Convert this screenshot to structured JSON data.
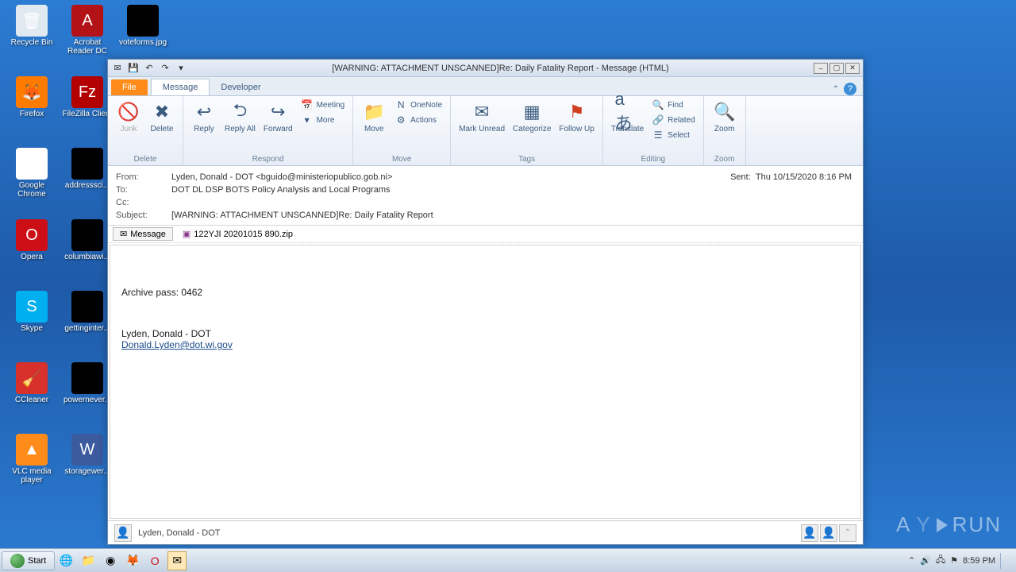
{
  "desktop_icons": [
    {
      "label": "Recycle Bin",
      "row": 0,
      "col": 0,
      "color": "#e0e8f0",
      "emoji": "🗑"
    },
    {
      "label": "Acrobat Reader DC",
      "row": 0,
      "col": 1,
      "color": "#b31217",
      "emoji": "A"
    },
    {
      "label": "voteforms.jpg",
      "row": 0,
      "col": 2,
      "color": "#000",
      "emoji": ""
    },
    {
      "label": "Firefox",
      "row": 1,
      "col": 0,
      "color": "#ff7b00",
      "emoji": "🦊"
    },
    {
      "label": "FileZilla Client",
      "row": 1,
      "col": 1,
      "color": "#b30000",
      "emoji": "Fz"
    },
    {
      "label": "Google Chrome",
      "row": 2,
      "col": 0,
      "color": "#fff",
      "emoji": "◉"
    },
    {
      "label": "addresssci...",
      "row": 2,
      "col": 1,
      "color": "#000",
      "emoji": ""
    },
    {
      "label": "Opera",
      "row": 3,
      "col": 0,
      "color": "#cc0f16",
      "emoji": "O"
    },
    {
      "label": "columbiawi...",
      "row": 3,
      "col": 1,
      "color": "#000",
      "emoji": ""
    },
    {
      "label": "Skype",
      "row": 4,
      "col": 0,
      "color": "#00aff0",
      "emoji": "S"
    },
    {
      "label": "gettinginter...",
      "row": 4,
      "col": 1,
      "color": "#000",
      "emoji": ""
    },
    {
      "label": "CCleaner",
      "row": 5,
      "col": 0,
      "color": "#d8302a",
      "emoji": "🧹"
    },
    {
      "label": "powernever...",
      "row": 5,
      "col": 1,
      "color": "#000",
      "emoji": ""
    },
    {
      "label": "VLC media player",
      "row": 6,
      "col": 0,
      "color": "#ff8c1a",
      "emoji": "▲"
    },
    {
      "label": "storagewer...",
      "row": 6,
      "col": 1,
      "color": "#3b5b9e",
      "emoji": "W"
    }
  ],
  "window": {
    "title": "[WARNING: ATTACHMENT UNSCANNED]Re: Daily Fatality Report -  Message (HTML)"
  },
  "tabs": {
    "file": "File",
    "message": "Message",
    "developer": "Developer"
  },
  "ribbon": {
    "junk": "Junk",
    "delete": "Delete",
    "reply": "Reply",
    "reply_all": "Reply All",
    "forward": "Forward",
    "meeting": "Meeting",
    "more": "More",
    "move": "Move",
    "onenote": "OneNote",
    "actions": "Actions",
    "mark_unread": "Mark Unread",
    "categorize": "Categorize",
    "follow_up": "Follow Up",
    "translate": "Translate",
    "find": "Find",
    "related": "Related",
    "select": "Select",
    "zoom": "Zoom",
    "g_delete": "Delete",
    "g_respond": "Respond",
    "g_move": "Move",
    "g_tags": "Tags",
    "g_editing": "Editing",
    "g_zoom": "Zoom"
  },
  "header": {
    "from_k": "From:",
    "from_v": "Lyden, Donald - DOT <bguido@ministeriopublico.gob.ni>",
    "to_k": "To:",
    "to_v": "DOT DL DSP BOTS Policy Analysis and Local Programs",
    "cc_k": "Cc:",
    "cc_v": "",
    "subj_k": "Subject:",
    "subj_v": "[WARNING: ATTACHMENT UNSCANNED]Re: Daily Fatality Report",
    "sent_k": "Sent:",
    "sent_v": "Thu 10/15/2020 8:16 PM"
  },
  "attachment": {
    "tab": "Message",
    "file": "122YJI 20201015 890.zip"
  },
  "body": {
    "line1": "Archive pass: 0462",
    "sig_name": "Lyden, Donald - DOT",
    "sig_email": "Donald.Lyden@dot.wi.gov"
  },
  "people": {
    "name": "Lyden, Donald - DOT"
  },
  "taskbar": {
    "start": "Start",
    "time": "8:59 PM"
  },
  "watermark": {
    "a": "A",
    "n": "Y",
    "run": "RUN"
  }
}
